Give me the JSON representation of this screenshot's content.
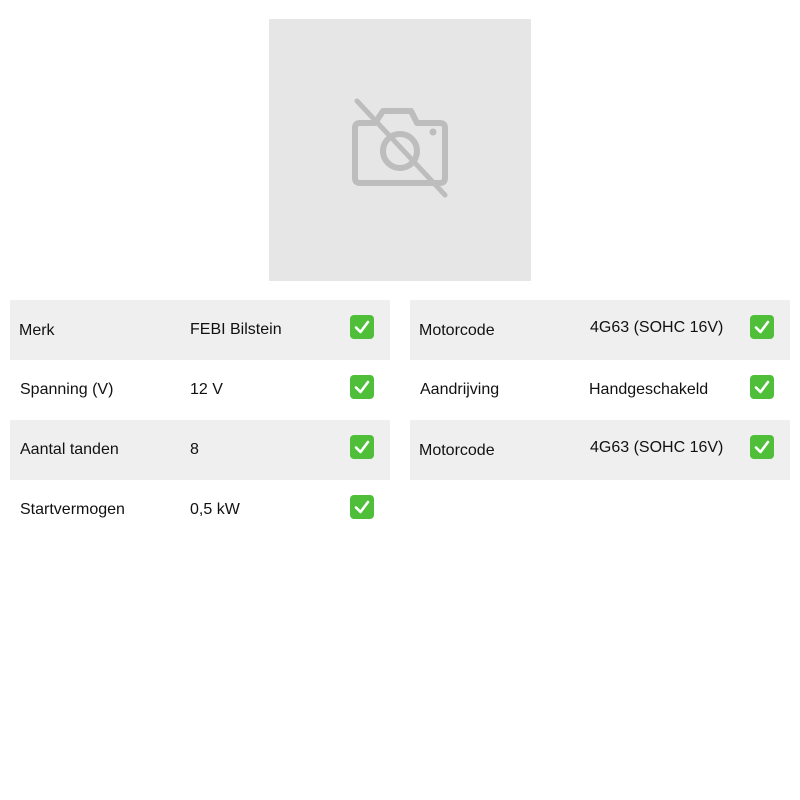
{
  "image": {
    "icon": "no-camera-icon"
  },
  "specs_left": [
    {
      "label": "Merk",
      "value": "FEBI Bilstein",
      "icon": "check-icon"
    },
    {
      "label": "Spanning (V)",
      "value": "12 V",
      "icon": "check-icon"
    },
    {
      "label": "Aantal tanden",
      "value": "8",
      "icon": "check-icon"
    },
    {
      "label": "Startvermogen",
      "value": "0,5 kW",
      "icon": "check-icon"
    }
  ],
  "specs_right": [
    {
      "label": "Motorcode",
      "value": "4G63 (SOHC 16V)",
      "icon": "check-icon"
    },
    {
      "label": "Aandrijving",
      "value": "Handgeschakeld",
      "icon": "check-icon"
    },
    {
      "label": "Motorcode",
      "value": "4G63 (SOHC 16V)",
      "icon": "check-icon"
    }
  ],
  "colors": {
    "placeholder_bg": "#e6e6e6",
    "row_shade": "#efefef",
    "check_green": "#4fbf3a"
  }
}
